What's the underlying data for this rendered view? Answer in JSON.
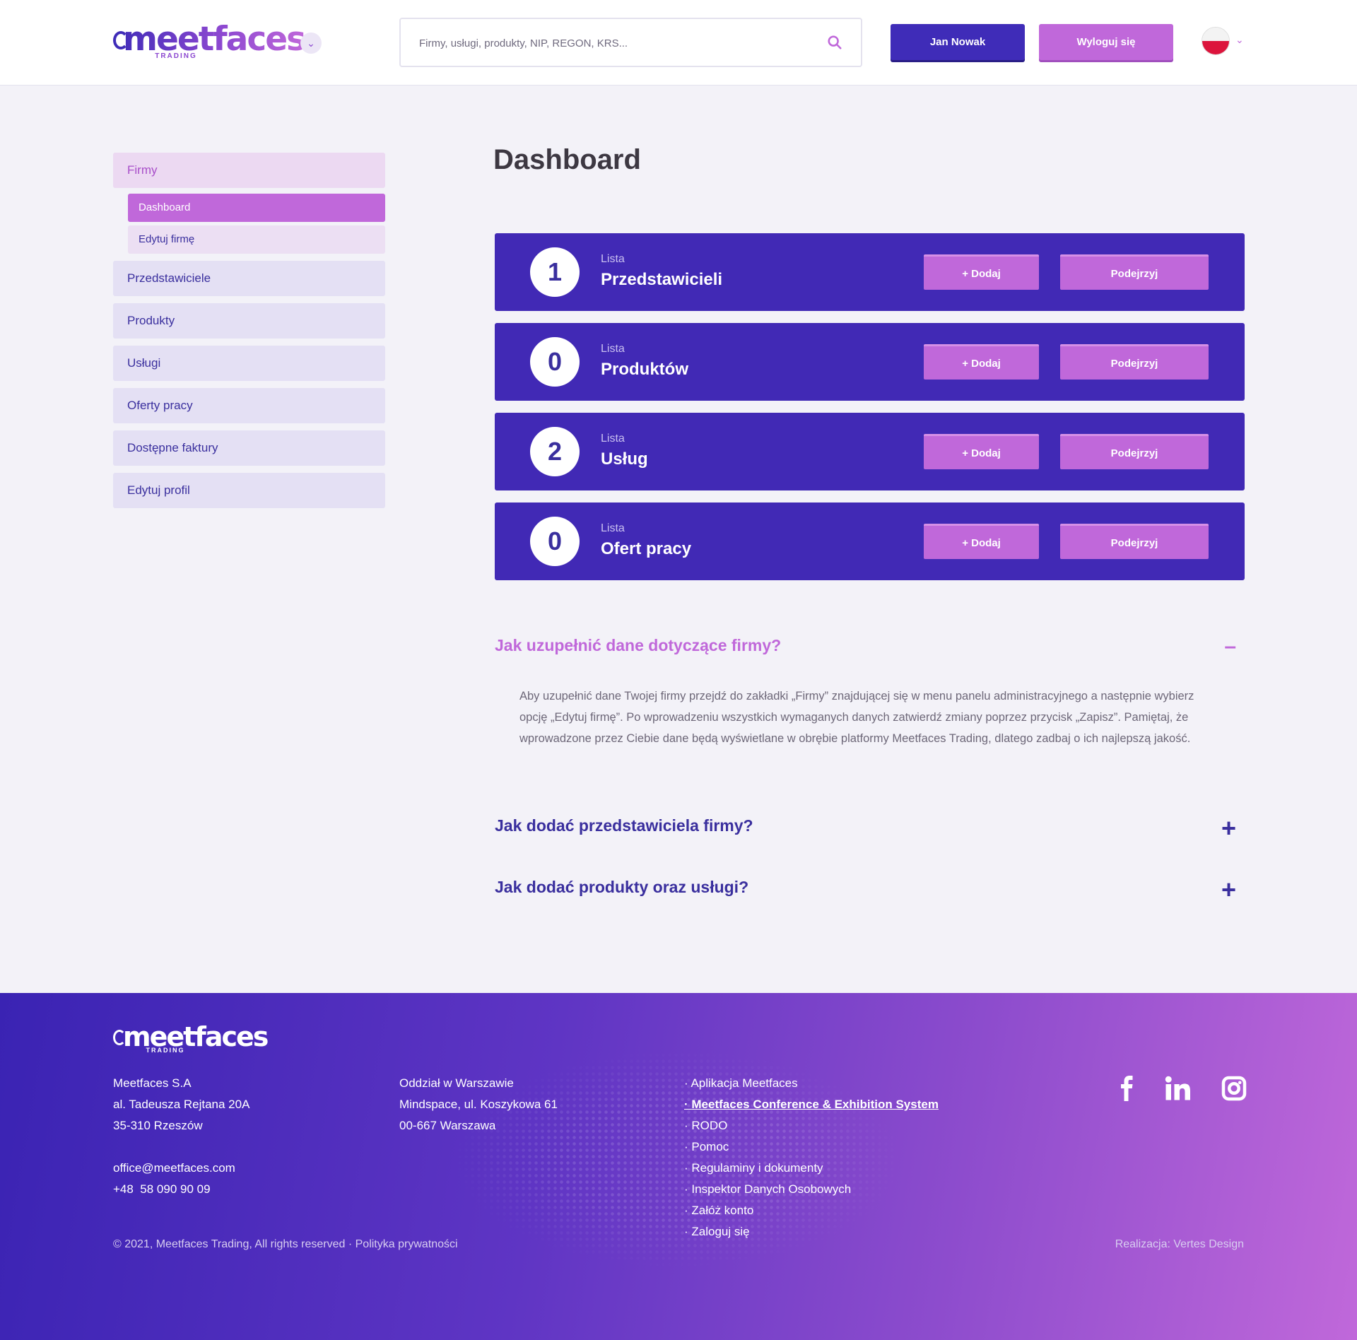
{
  "header": {
    "logo_text": "meetfaces",
    "logo_sub": "TRADING",
    "search_placeholder": "Firmy, usługi, produkty, NIP, REGON, KRS...",
    "user_button": "Jan Nowak",
    "logout_button": "Wyloguj się",
    "language": "PL",
    "colors": {
      "primary": "#3f2cb8",
      "accent": "#c068da"
    }
  },
  "sidebar": {
    "items": [
      {
        "label": "Firmy"
      },
      {
        "label": "Przedstawiciele"
      },
      {
        "label": "Produkty"
      },
      {
        "label": "Usługi"
      },
      {
        "label": "Oferty pracy"
      },
      {
        "label": "Dostępne faktury"
      },
      {
        "label": "Edytuj profil"
      }
    ],
    "sub_items": [
      {
        "label": "Dashboard",
        "active": true
      },
      {
        "label": "Edytuj firmę",
        "active": false
      }
    ]
  },
  "main": {
    "title": "Dashboard",
    "cards": [
      {
        "count": "1",
        "kicker": "Lista",
        "title": "Przedstawicieli",
        "add": "+ Dodaj",
        "view": "Podejrzyj"
      },
      {
        "count": "0",
        "kicker": "Lista",
        "title": "Produktów",
        "add": "+ Dodaj",
        "view": "Podejrzyj"
      },
      {
        "count": "2",
        "kicker": "Lista",
        "title": "Usług",
        "add": "+ Dodaj",
        "view": "Podejrzyj"
      },
      {
        "count": "0",
        "kicker": "Lista",
        "title": "Ofert pracy",
        "add": "+ Dodaj",
        "view": "Podejrzyj"
      }
    ]
  },
  "faq": [
    {
      "question": "Jak uzupełnić dane dotyczące firmy?",
      "answer": "Aby uzupełnić dane Twojej firmy przejdź do zakładki „Firmy” znajdującej się w menu panelu administracyjnego a następnie wybierz opcję „Edytuj firmę”. Po wprowadzeniu wszystkich wymaganych danych zatwierdź zmiany poprzez przycisk „Zapisz”. Pamiętaj, że wprowadzone przez Ciebie dane będą wyświetlane w obrębie platformy Meetfaces Trading, dlatego zadbaj o ich najlepszą jakość.",
      "toggle": "–",
      "open": true
    },
    {
      "question": "Jak dodać przedstawiciela firmy?",
      "toggle": "+",
      "open": false
    },
    {
      "question": "Jak dodać produkty oraz usługi?",
      "toggle": "+",
      "open": false
    }
  ],
  "footer": {
    "logo_text": "meetfaces",
    "logo_sub": "TRADING",
    "company": [
      "Meetfaces S.A",
      "al. Tadeusza Rejtana 20A",
      "35-310 Rzeszów"
    ],
    "contact": [
      "office@meetfaces.com",
      "+48  58 090 90 09"
    ],
    "branch": [
      "Oddział w Warszawie",
      "Mindspace, ul. Koszykowa 61",
      "00-667 Warszawa"
    ],
    "links": [
      "Aplikacja Meetfaces",
      "Meetfaces Conference & Exhibition System",
      "RODO",
      "Pomoc",
      "Regulaminy i dokumenty",
      "Inspektor Danych Osobowych",
      "Załóż konto",
      "Zaloguj się"
    ],
    "social_icons": [
      "facebook-icon",
      "linkedin-icon",
      "instagram-icon"
    ],
    "copyright": "© 2021, Meetfaces Trading, All rights reserved · Polityka prywatności",
    "credit": "Realizacja: Vertes Design"
  }
}
